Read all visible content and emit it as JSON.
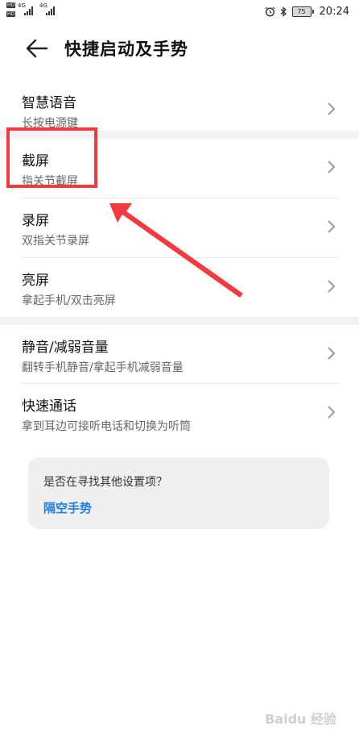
{
  "status_bar": {
    "hd_badge": "HD",
    "network_left": "4G",
    "network_right": "4G",
    "battery": "75",
    "time": "20:24",
    "icons": [
      "alarm-icon",
      "bluetooth-icon",
      "battery-icon"
    ]
  },
  "header": {
    "title": "快捷启动及手势",
    "back_icon": "back-arrow-icon"
  },
  "rows": [
    {
      "title": "智慧语音",
      "subtitle": "长按电源键"
    },
    {
      "title": "截屏",
      "subtitle": "指关节截屏"
    },
    {
      "title": "录屏",
      "subtitle": "双指关节录屏"
    },
    {
      "title": "亮屏",
      "subtitle": "拿起手机/双击亮屏"
    },
    {
      "title": "静音/减弱音量",
      "subtitle": "翻转手机静音/拿起手机减弱音量"
    },
    {
      "title": "快速通话",
      "subtitle": "拿到耳边可接听电话和切换为听筒"
    }
  ],
  "hint_card": {
    "question": "是否在寻找其他设置项？",
    "link": "隔空手势"
  },
  "annotation": {
    "highlight_color": "#f23a3f"
  },
  "watermark": "Baidu 经验",
  "colors": {
    "link": "#1d7fe0",
    "section_gap": "#f3f3f3",
    "card": "#efefef"
  }
}
